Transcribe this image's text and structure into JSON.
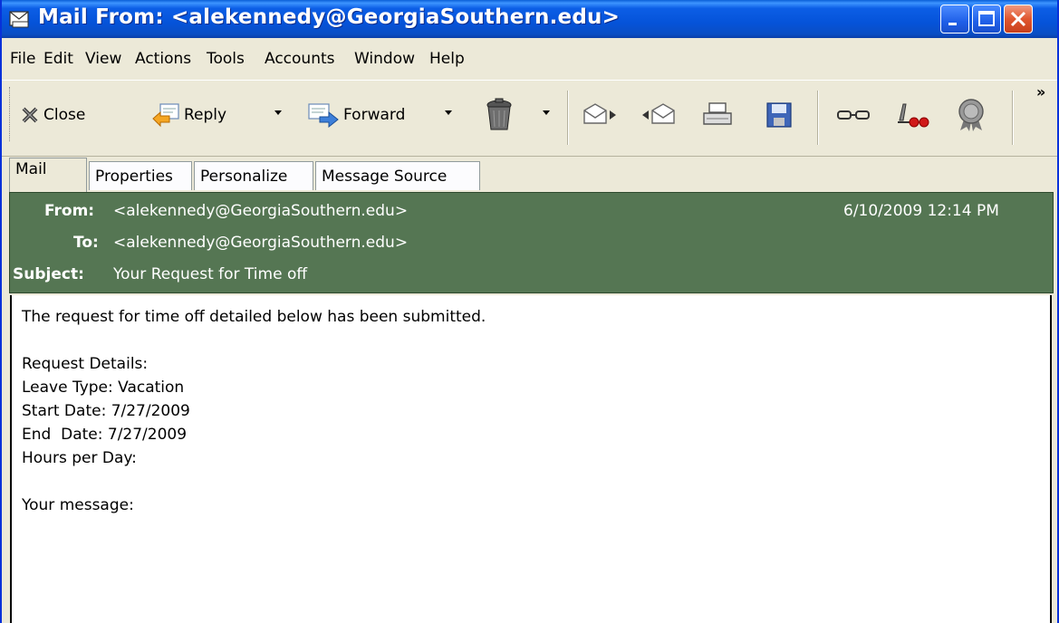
{
  "window": {
    "title": "Mail From: <alekennedy@GeorgiaSouthern.edu>",
    "icon": "envelope-window-icon"
  },
  "menu": [
    "File",
    "Edit",
    "View",
    "Actions",
    "Tools",
    "Accounts",
    "Window",
    "Help"
  ],
  "toolbar": {
    "close_label": "Close",
    "reply_label": "Reply",
    "forward_label": "Forward",
    "overflow": "»"
  },
  "tabs": [
    "Mail",
    "Properties",
    "Personalize",
    "Message Source"
  ],
  "header": {
    "from_label": "From:",
    "from_value": "<alekennedy@GeorgiaSouthern.edu>",
    "to_label": "To:",
    "to_value": "<alekennedy@GeorgiaSouthern.edu>",
    "subject_label": "Subject:",
    "subject_value": "Your Request for Time off",
    "date": "6/10/2009 12:14 PM"
  },
  "body": {
    "lines": [
      "The request for time off detailed below has been submitted.",
      "",
      "Request Details:",
      "Leave Type: Vacation",
      "Start Date: 7/27/2009",
      "End  Date: 7/27/2009",
      "Hours per Day:",
      "",
      "Your message:"
    ]
  },
  "colors": {
    "title_bar": "#0553d9",
    "header_bg": "#557653",
    "window_bg": "#ece9d8"
  }
}
